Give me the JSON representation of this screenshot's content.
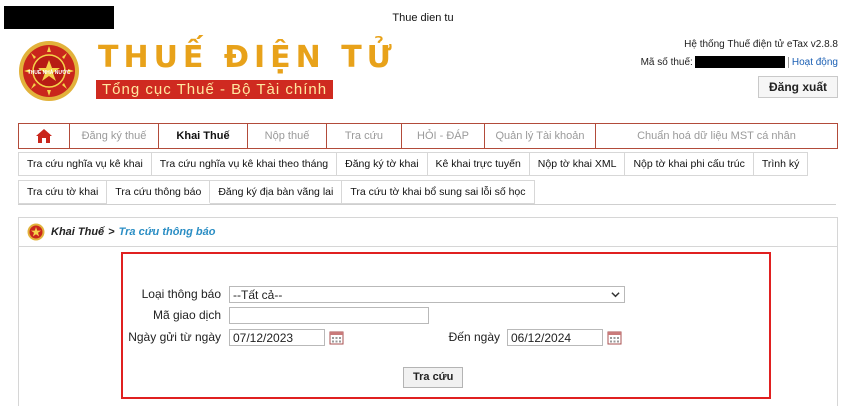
{
  "window": {
    "title": "Thue dien tu"
  },
  "header": {
    "brand_title": "THUẾ ĐIỆN TỬ",
    "brand_subtitle": "Tổng cục Thuế - Bộ Tài chính",
    "emblem_text": "THUẾ NHÀ NƯỚC",
    "system_info": "Hệ thống Thuế điện tử eTax v2.8.8",
    "tax_code_label": "Mã số thuế:",
    "status_link": "Hoạt động",
    "logout_label": "Đăng xuất"
  },
  "main_nav": {
    "items": [
      {
        "label": "Đăng ký thuế"
      },
      {
        "label": "Khai Thuế"
      },
      {
        "label": "Nộp thuế"
      },
      {
        "label": "Tra cứu"
      },
      {
        "label": "HỎI - ĐÁP"
      },
      {
        "label": "Quản lý Tài khoản"
      },
      {
        "label": "Chuẩn hoá dữ liệu MST cá nhân"
      }
    ],
    "active_index": 1
  },
  "sub_nav": {
    "row1": [
      {
        "label": "Tra cứu nghĩa vụ kê khai"
      },
      {
        "label": "Tra cứu nghĩa vụ kê khai theo tháng"
      },
      {
        "label": "Đăng ký tờ khai"
      },
      {
        "label": "Kê khai trực tuyến"
      },
      {
        "label": "Nộp tờ khai XML"
      },
      {
        "label": "Nộp tờ khai phi cấu trúc"
      },
      {
        "label": "Trình ký"
      }
    ],
    "row2": [
      {
        "label": "Tra cứu tờ khai"
      },
      {
        "label": "Tra cứu thông báo"
      },
      {
        "label": "Đăng ký địa bàn vãng lai"
      },
      {
        "label": "Tra cứu tờ khai bổ sung sai lỗi số học"
      }
    ],
    "active": "Tra cứu thông báo"
  },
  "breadcrumb": {
    "parent": "Khai Thuế",
    "separator": ">",
    "current": "Tra cứu thông báo"
  },
  "form": {
    "notice_type_label": "Loại thông báo",
    "notice_type_value": "--Tất cả--",
    "transaction_code_label": "Mã giao dịch",
    "transaction_code_value": "",
    "from_date_label": "Ngày gửi từ ngày",
    "from_date_value": "07/12/2023",
    "to_date_label": "Đến ngày",
    "to_date_value": "06/12/2024",
    "search_label": "Tra cứu"
  },
  "colors": {
    "brand_gold": "#e8a21a",
    "brand_red": "#cf2a20",
    "nav_border": "#b24b3a",
    "highlight_box": "#e02020",
    "link_blue": "#2b8ec4"
  },
  "icons": [
    "home-icon",
    "calendar-icon",
    "dropdown-arrow-icon",
    "emblem-icon"
  ]
}
